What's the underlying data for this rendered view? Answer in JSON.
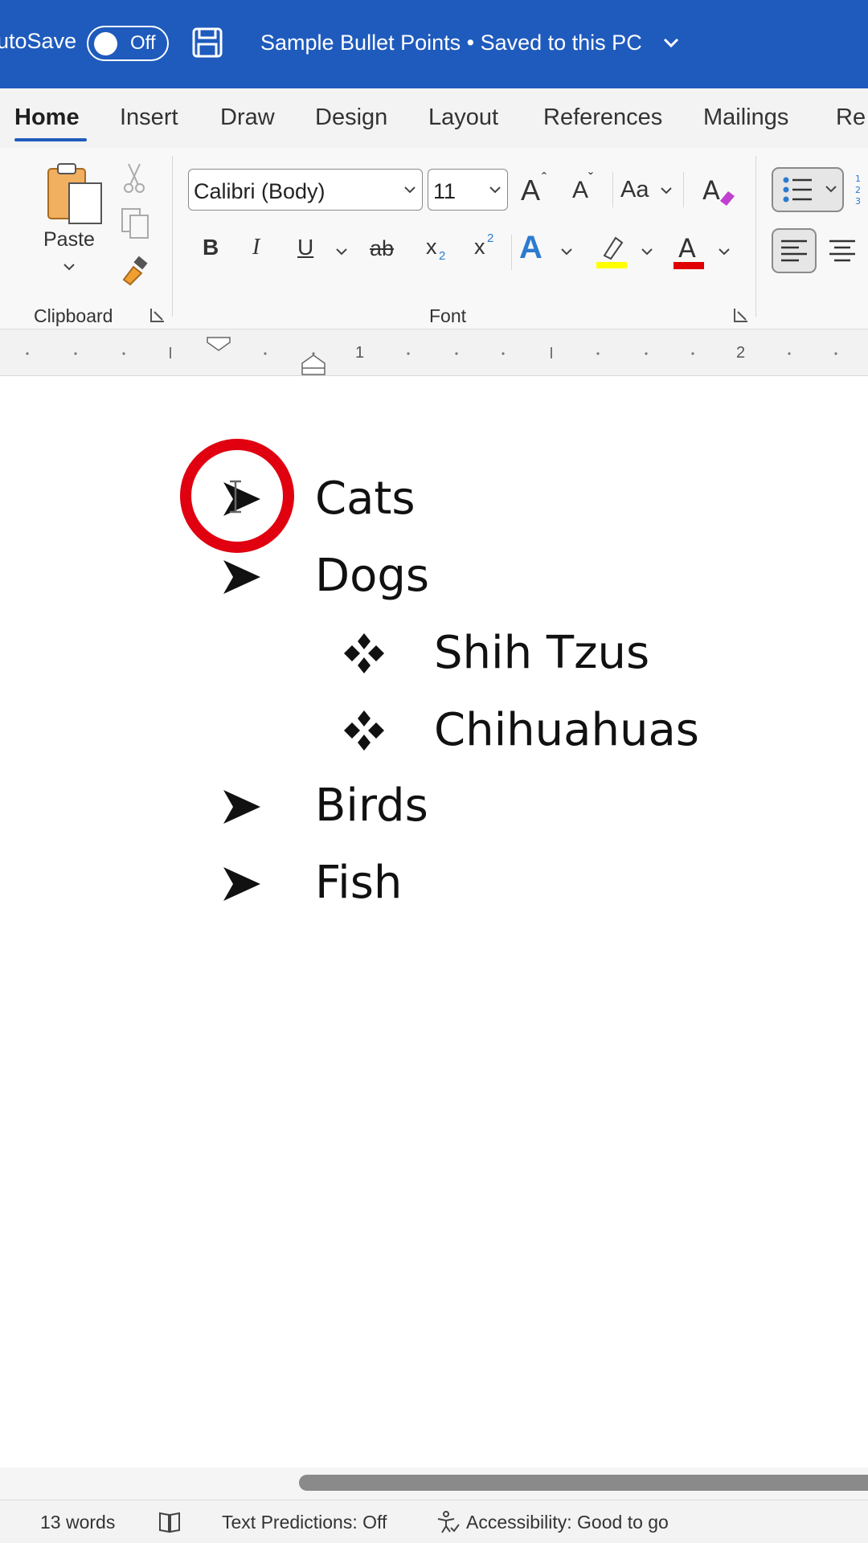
{
  "titlebar": {
    "autosave_label": "AutoSave",
    "autosave_state": "Off",
    "doc_title": "Sample Bullet Points • Saved to this PC"
  },
  "tabs": [
    "Home",
    "Insert",
    "Draw",
    "Design",
    "Layout",
    "References",
    "Mailings",
    "Re"
  ],
  "ribbon": {
    "paste_label": "Paste",
    "clipboard_label": "Clipboard",
    "font_label": "Font",
    "font_name": "Calibri (Body)",
    "font_size": "11",
    "grow_font": "A",
    "shrink_font": "A",
    "change_case": "Aa",
    "bold": "B",
    "italic": "I",
    "underline": "U",
    "strike": "ab",
    "subscript": "x",
    "superscript": "x",
    "font_color_letter": "A",
    "text_effects_letter": "A"
  },
  "ruler": {
    "marks": [
      "1",
      "2"
    ]
  },
  "document": {
    "items": [
      {
        "text": "Cats",
        "level": 1
      },
      {
        "text": "Dogs",
        "level": 1
      },
      {
        "text": "Shih Tzus",
        "level": 2
      },
      {
        "text": "Chihuahuas",
        "level": 2
      },
      {
        "text": "Birds",
        "level": 1
      },
      {
        "text": "Fish",
        "level": 1
      }
    ]
  },
  "status": {
    "word_count": "13 words",
    "text_predictions": "Text Predictions: Off",
    "accessibility": "Accessibility: Good to go"
  },
  "colors": {
    "titlebar": "#1f5bbd",
    "highlight_ring": "#e0000f",
    "highlighter": "#ffff00",
    "font_color": "#e00000"
  }
}
